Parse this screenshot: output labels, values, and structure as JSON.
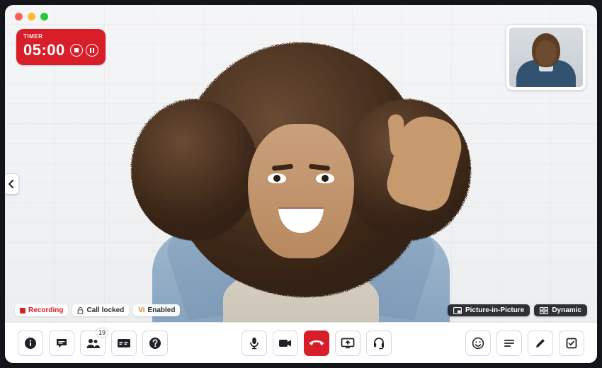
{
  "timer": {
    "label": "TIMER",
    "value": "05:00",
    "stop_icon": "stop-icon",
    "pause_icon": "pause-icon"
  },
  "status": {
    "recording_label": "Recording",
    "call_locked_label": "Call locked",
    "vi_enabled_prefix": "Vi",
    "vi_enabled_label": "Enabled"
  },
  "view_controls": {
    "pip_label": "Picture-in-Picture",
    "dynamic_label": "Dynamic"
  },
  "toolbar": {
    "left": {
      "info": "info-icon",
      "chat": "chat-icon",
      "participants": "participants-icon",
      "participants_badge": "19",
      "cc": "cc-icon",
      "help": "help-icon"
    },
    "center": {
      "mic": "microphone-icon",
      "camera": "camera-icon",
      "hangup": "hangup-icon",
      "share": "share-screen-icon",
      "audio": "headset-icon"
    },
    "right": {
      "reactions": "smile-icon",
      "notes": "notes-icon",
      "draw": "pencil-icon",
      "tasks": "checkbox-icon"
    }
  },
  "colors": {
    "accent": "#d81e28"
  }
}
